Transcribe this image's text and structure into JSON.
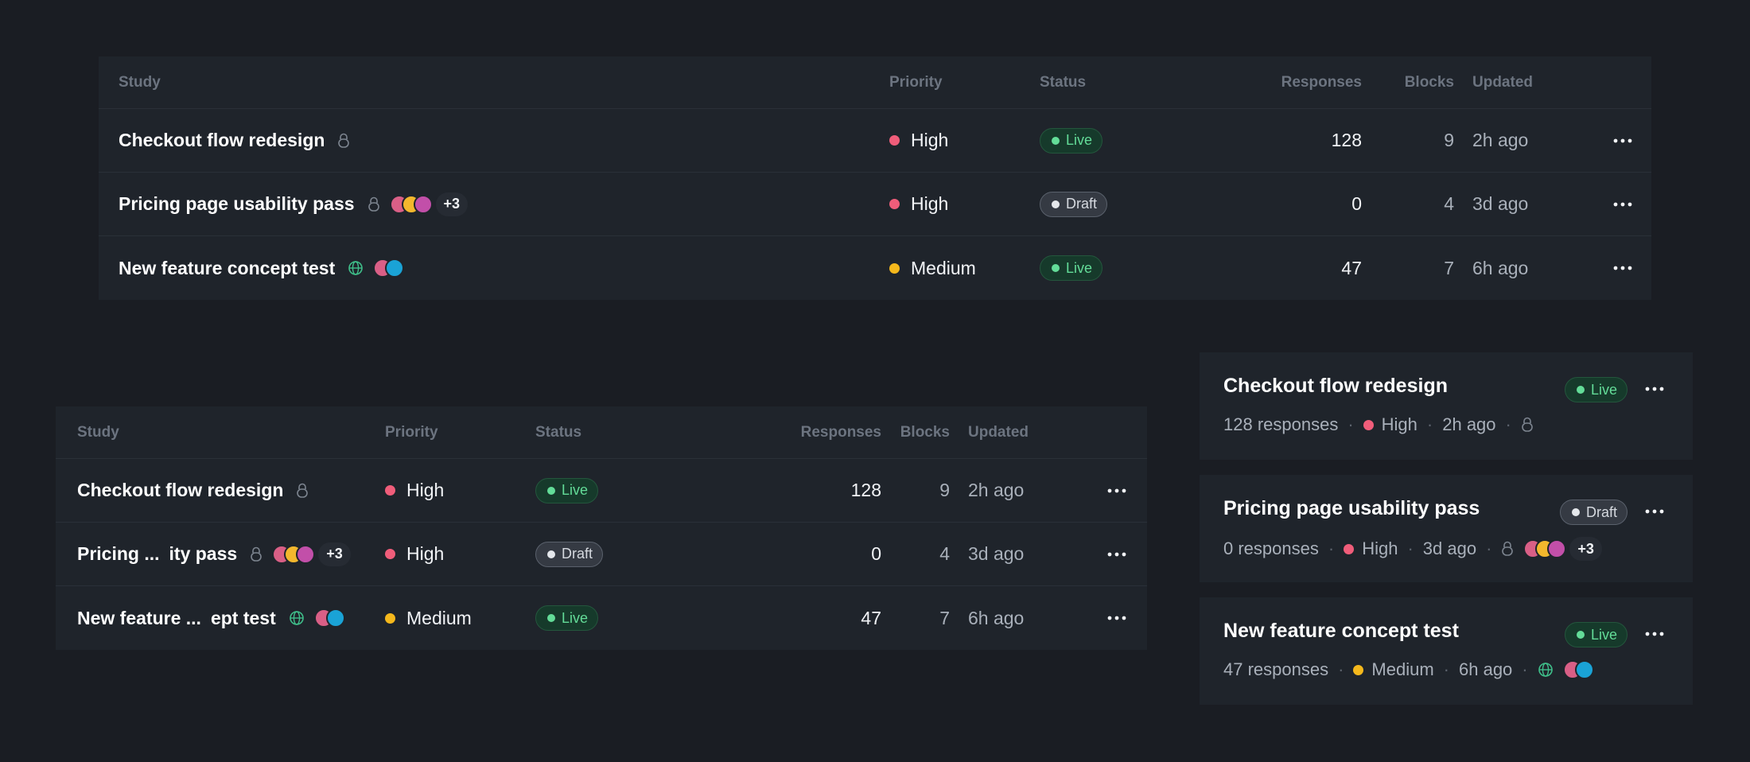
{
  "colors": {
    "background": "#1a1d23",
    "panel": "#1f242b",
    "priority_high": "#f05d7a",
    "priority_medium": "#f5b81c",
    "live_text": "#63dc98",
    "draft_text": "#d5d9df"
  },
  "columns": {
    "study": "Study",
    "priority": "Priority",
    "status": "Status",
    "responses": "Responses",
    "blocks": "Blocks",
    "updated": "Updated"
  },
  "studies": [
    {
      "name": "Checkout flow redesign",
      "name_short_start": "Checkout flow redesign",
      "name_short_end": "",
      "visibility_icon": "lock-icon",
      "collaborators": [],
      "more_count": "",
      "priority": "High",
      "priority_color": "#f05d7a",
      "status": "Live",
      "responses": "128",
      "responses_label": "128 responses",
      "blocks": "9",
      "updated": "2h ago"
    },
    {
      "name": "Pricing page usability pass",
      "name_short_start": "Pricing ...",
      "name_short_end": "ity pass",
      "visibility_icon": "lock-icon",
      "collaborators": [
        "#d95f86",
        "#f3b72d",
        "#c24fa9"
      ],
      "more_count": "+3",
      "priority": "High",
      "priority_color": "#f05d7a",
      "status": "Draft",
      "responses": "0",
      "responses_label": "0 responses",
      "blocks": "4",
      "updated": "3d ago"
    },
    {
      "name": "New feature concept test",
      "name_short_start": "New feature ...",
      "name_short_end": "ept test",
      "visibility_icon": "globe-icon",
      "collaborators": [
        "#d95f86",
        "#1aa3d6"
      ],
      "more_count": "",
      "priority": "Medium",
      "priority_color": "#f5b81c",
      "status": "Live",
      "responses": "47",
      "responses_label": "47 responses",
      "blocks": "7",
      "updated": "6h ago"
    }
  ]
}
